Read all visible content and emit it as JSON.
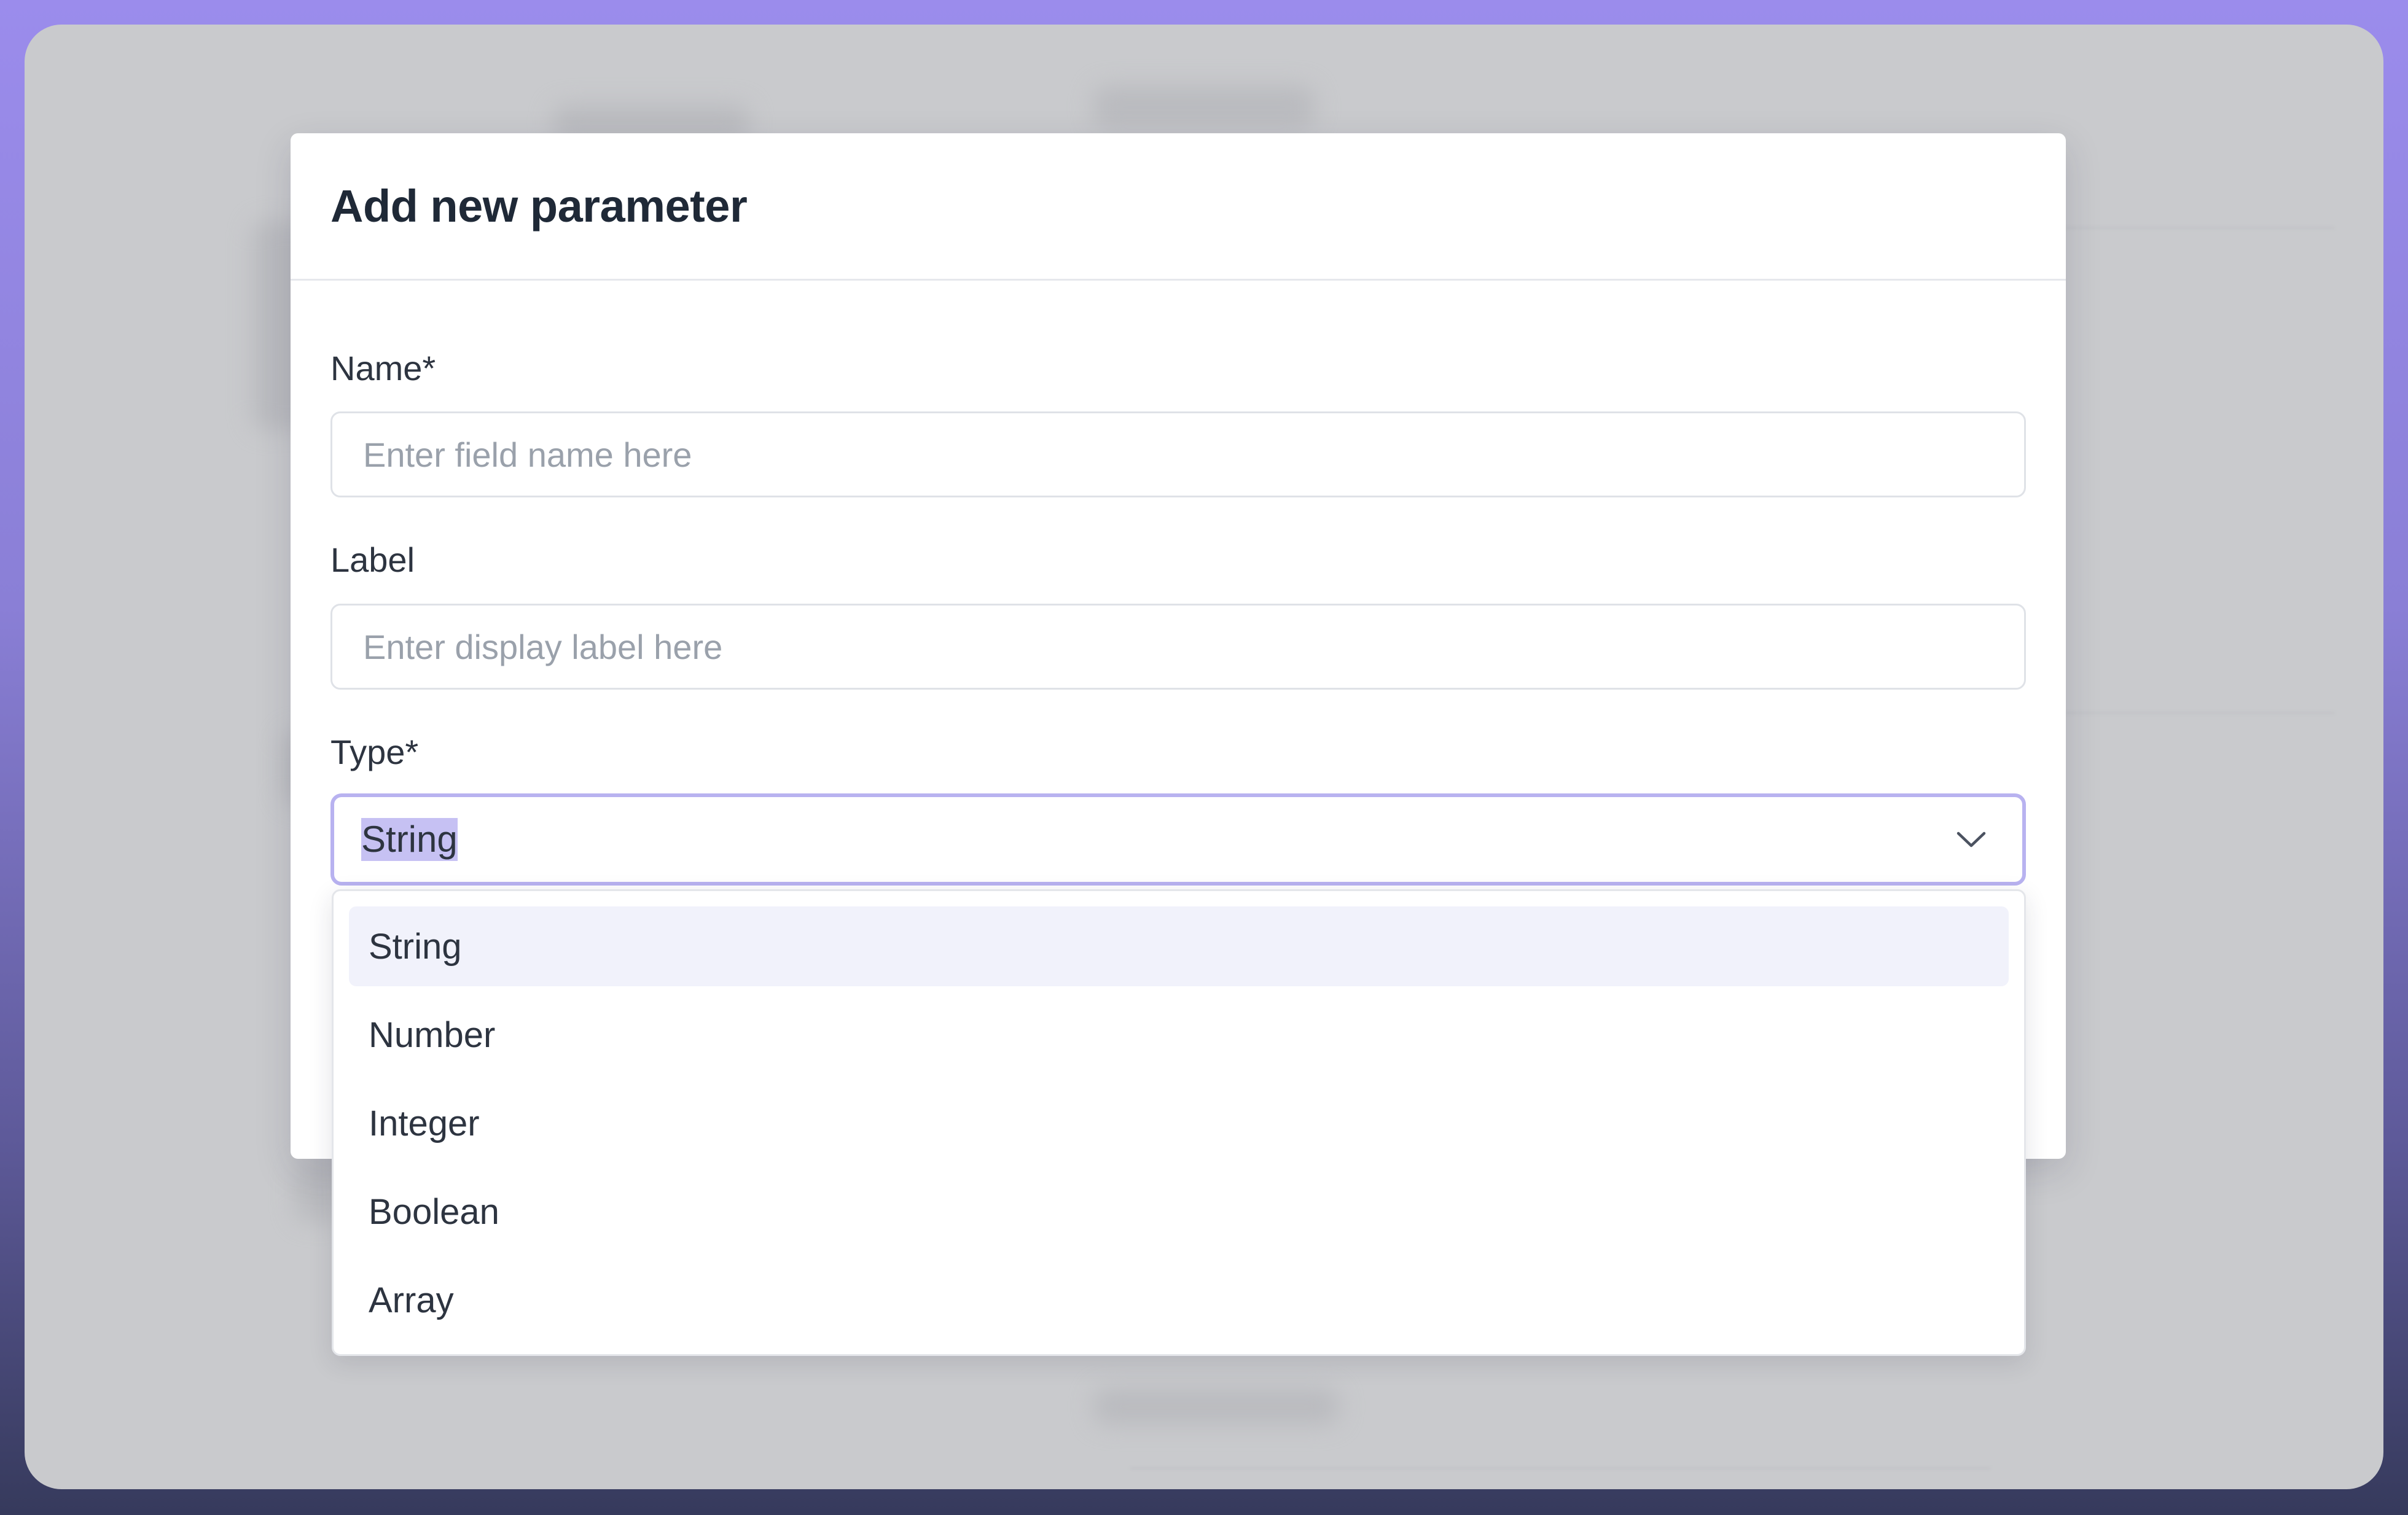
{
  "modal": {
    "title": "Add new parameter",
    "name_field": {
      "label": "Name*",
      "placeholder": "Enter field name here",
      "value": ""
    },
    "label_field": {
      "label": "Label",
      "placeholder": "Enter display label here",
      "value": ""
    },
    "type_field": {
      "label": "Type*",
      "selected": "String"
    }
  },
  "dropdown": {
    "options": [
      {
        "label": "String",
        "highlighted": true
      },
      {
        "label": "Number",
        "highlighted": false
      },
      {
        "label": "Integer",
        "highlighted": false
      },
      {
        "label": "Boolean",
        "highlighted": false
      },
      {
        "label": "Array",
        "highlighted": false
      }
    ]
  },
  "icons": {
    "select_chevron": "chevron-down-icon"
  },
  "colors": {
    "focus_border": "#b8b2f0",
    "selection_highlight": "#c6c1f3",
    "option_hover": "#f1f2fb",
    "backdrop": "#c9cacd"
  }
}
